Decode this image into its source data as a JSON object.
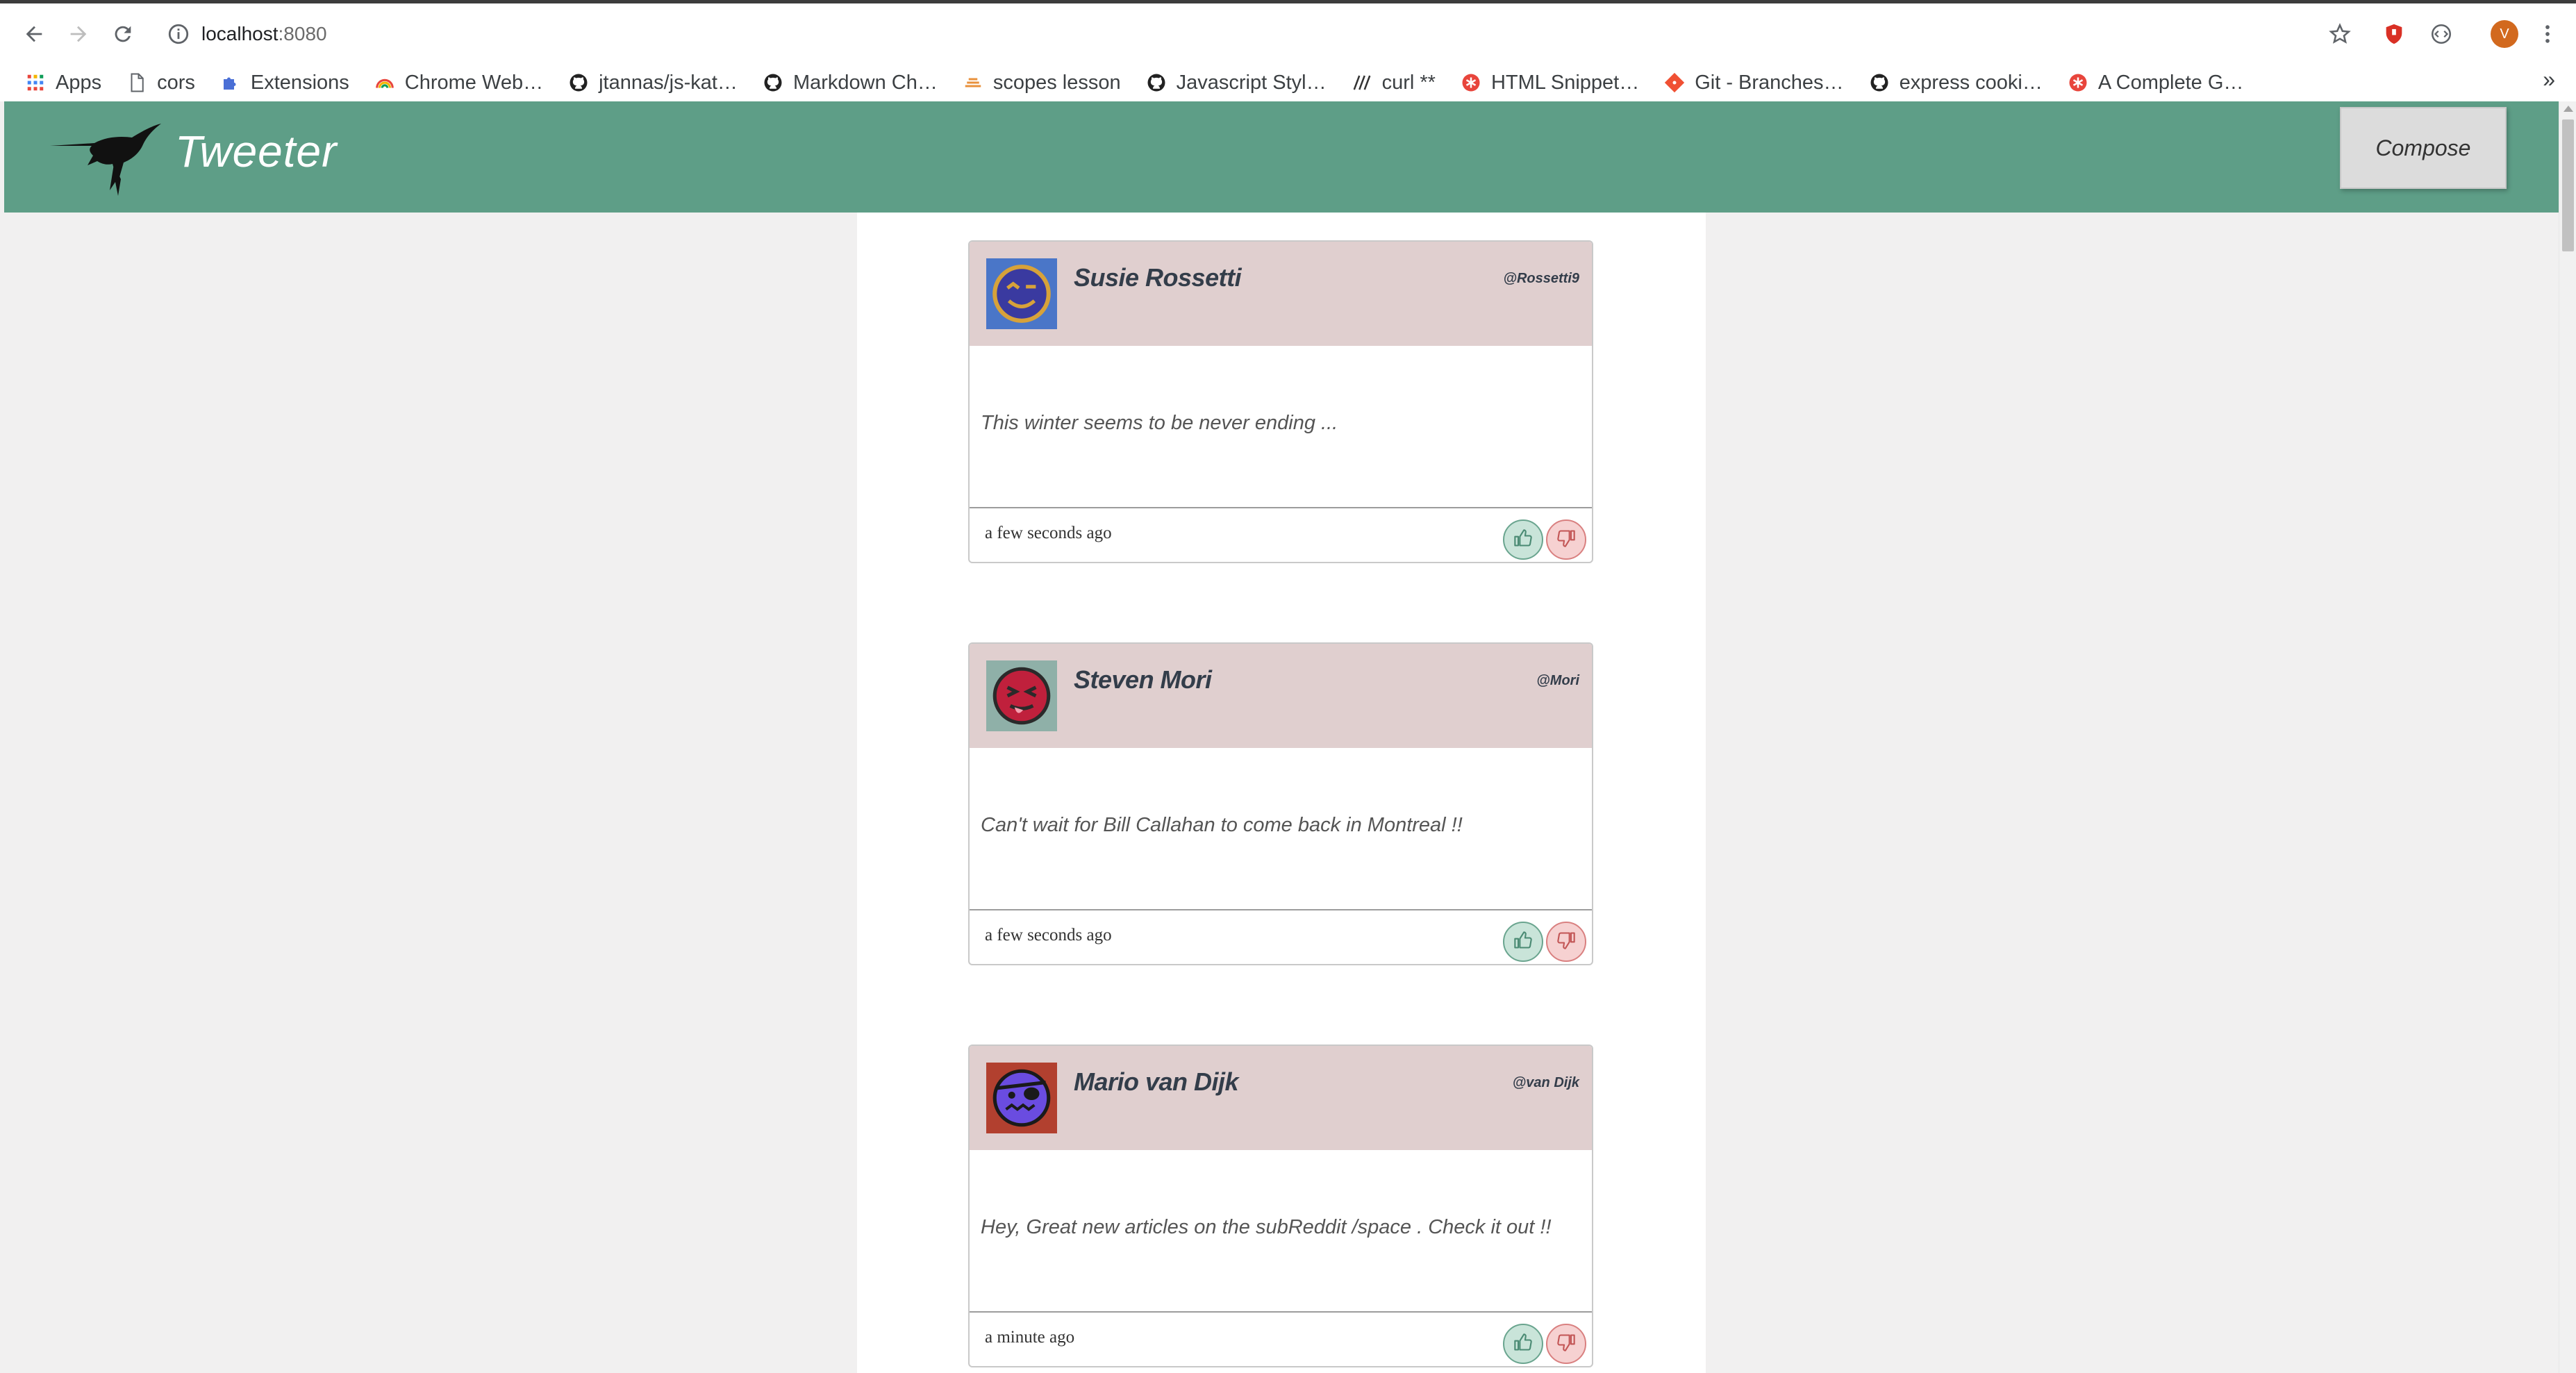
{
  "browser": {
    "url_host": "localhost",
    "url_port": ":8080",
    "profile_initial": "V",
    "bookmarks": [
      {
        "label": "Apps",
        "icon": "apps-grid-icon"
      },
      {
        "label": "cors",
        "icon": "page-icon"
      },
      {
        "label": "Extensions",
        "icon": "puzzle-icon"
      },
      {
        "label": "Chrome Web…",
        "icon": "rainbow-icon"
      },
      {
        "label": "jtannas/js-kat…",
        "icon": "github-icon"
      },
      {
        "label": "Markdown Ch…",
        "icon": "github-icon"
      },
      {
        "label": "scopes lesson",
        "icon": "stack-icon"
      },
      {
        "label": "Javascript Styl…",
        "icon": "github-icon"
      },
      {
        "label": "curl **",
        "icon": "slashes-icon"
      },
      {
        "label": "HTML Snippet…",
        "icon": "asterisk-icon"
      },
      {
        "label": "Git - Branches…",
        "icon": "git-icon"
      },
      {
        "label": "express cooki…",
        "icon": "github-icon"
      },
      {
        "label": "A Complete G…",
        "icon": "asterisk-icon"
      }
    ],
    "bookmarks_more": "»"
  },
  "nav": {
    "brand": "Tweeter",
    "compose_label": "Compose"
  },
  "tweets": [
    {
      "name": "Susie Rossetti",
      "handle": "@Rossetti9",
      "text": "This winter seems to be never ending ...",
      "time": "a few seconds ago",
      "avatar_icon": "wink-face-icon",
      "avatar_bg": "#4a76c8",
      "avatar_face": "#3a3aa0",
      "avatar_ring": "#d7a23a"
    },
    {
      "name": "Steven Mori",
      "handle": "@Mori",
      "text": "Can't wait for Bill Callahan to come back in Montreal !!",
      "time": "a few seconds ago",
      "avatar_icon": "tongue-face-icon",
      "avatar_bg": "#8fb0a8",
      "avatar_face": "#c0203c",
      "avatar_ring": "#2a2a2a"
    },
    {
      "name": "Mario van Dijk",
      "handle": "@van Dijk",
      "text": "Hey, Great new articles on the subReddit /space . Check it out !!",
      "time": "a minute ago",
      "avatar_icon": "pirate-face-icon",
      "avatar_bg": "#b2402f",
      "avatar_face": "#6a4ce0",
      "avatar_ring": "#1a1a1a"
    }
  ],
  "colors": {
    "nav_bg": "#5e9e87",
    "tweet_header_bg": "#e0cfcf",
    "like_bg": "#c9e4d9",
    "dislike_bg": "#f6d1d1"
  }
}
